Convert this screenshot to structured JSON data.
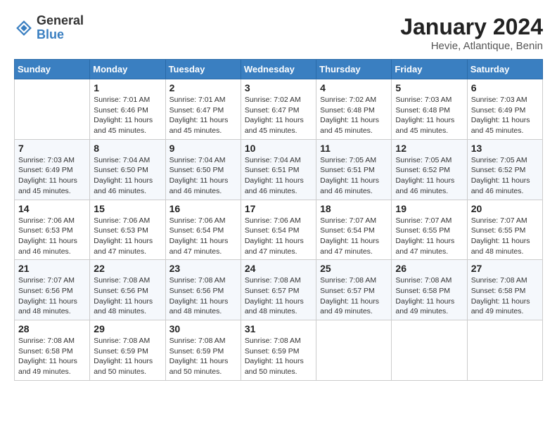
{
  "header": {
    "logo_general": "General",
    "logo_blue": "Blue",
    "month_year": "January 2024",
    "location": "Hevie, Atlantique, Benin"
  },
  "days_of_week": [
    "Sunday",
    "Monday",
    "Tuesday",
    "Wednesday",
    "Thursday",
    "Friday",
    "Saturday"
  ],
  "weeks": [
    [
      {
        "day": "",
        "info": ""
      },
      {
        "day": "1",
        "info": "Sunrise: 7:01 AM\nSunset: 6:46 PM\nDaylight: 11 hours\nand 45 minutes."
      },
      {
        "day": "2",
        "info": "Sunrise: 7:01 AM\nSunset: 6:47 PM\nDaylight: 11 hours\nand 45 minutes."
      },
      {
        "day": "3",
        "info": "Sunrise: 7:02 AM\nSunset: 6:47 PM\nDaylight: 11 hours\nand 45 minutes."
      },
      {
        "day": "4",
        "info": "Sunrise: 7:02 AM\nSunset: 6:48 PM\nDaylight: 11 hours\nand 45 minutes."
      },
      {
        "day": "5",
        "info": "Sunrise: 7:03 AM\nSunset: 6:48 PM\nDaylight: 11 hours\nand 45 minutes."
      },
      {
        "day": "6",
        "info": "Sunrise: 7:03 AM\nSunset: 6:49 PM\nDaylight: 11 hours\nand 45 minutes."
      }
    ],
    [
      {
        "day": "7",
        "info": "Sunrise: 7:03 AM\nSunset: 6:49 PM\nDaylight: 11 hours\nand 45 minutes."
      },
      {
        "day": "8",
        "info": "Sunrise: 7:04 AM\nSunset: 6:50 PM\nDaylight: 11 hours\nand 46 minutes."
      },
      {
        "day": "9",
        "info": "Sunrise: 7:04 AM\nSunset: 6:50 PM\nDaylight: 11 hours\nand 46 minutes."
      },
      {
        "day": "10",
        "info": "Sunrise: 7:04 AM\nSunset: 6:51 PM\nDaylight: 11 hours\nand 46 minutes."
      },
      {
        "day": "11",
        "info": "Sunrise: 7:05 AM\nSunset: 6:51 PM\nDaylight: 11 hours\nand 46 minutes."
      },
      {
        "day": "12",
        "info": "Sunrise: 7:05 AM\nSunset: 6:52 PM\nDaylight: 11 hours\nand 46 minutes."
      },
      {
        "day": "13",
        "info": "Sunrise: 7:05 AM\nSunset: 6:52 PM\nDaylight: 11 hours\nand 46 minutes."
      }
    ],
    [
      {
        "day": "14",
        "info": "Sunrise: 7:06 AM\nSunset: 6:53 PM\nDaylight: 11 hours\nand 46 minutes."
      },
      {
        "day": "15",
        "info": "Sunrise: 7:06 AM\nSunset: 6:53 PM\nDaylight: 11 hours\nand 47 minutes."
      },
      {
        "day": "16",
        "info": "Sunrise: 7:06 AM\nSunset: 6:54 PM\nDaylight: 11 hours\nand 47 minutes."
      },
      {
        "day": "17",
        "info": "Sunrise: 7:06 AM\nSunset: 6:54 PM\nDaylight: 11 hours\nand 47 minutes."
      },
      {
        "day": "18",
        "info": "Sunrise: 7:07 AM\nSunset: 6:54 PM\nDaylight: 11 hours\nand 47 minutes."
      },
      {
        "day": "19",
        "info": "Sunrise: 7:07 AM\nSunset: 6:55 PM\nDaylight: 11 hours\nand 47 minutes."
      },
      {
        "day": "20",
        "info": "Sunrise: 7:07 AM\nSunset: 6:55 PM\nDaylight: 11 hours\nand 48 minutes."
      }
    ],
    [
      {
        "day": "21",
        "info": "Sunrise: 7:07 AM\nSunset: 6:56 PM\nDaylight: 11 hours\nand 48 minutes."
      },
      {
        "day": "22",
        "info": "Sunrise: 7:08 AM\nSunset: 6:56 PM\nDaylight: 11 hours\nand 48 minutes."
      },
      {
        "day": "23",
        "info": "Sunrise: 7:08 AM\nSunset: 6:56 PM\nDaylight: 11 hours\nand 48 minutes."
      },
      {
        "day": "24",
        "info": "Sunrise: 7:08 AM\nSunset: 6:57 PM\nDaylight: 11 hours\nand 48 minutes."
      },
      {
        "day": "25",
        "info": "Sunrise: 7:08 AM\nSunset: 6:57 PM\nDaylight: 11 hours\nand 49 minutes."
      },
      {
        "day": "26",
        "info": "Sunrise: 7:08 AM\nSunset: 6:58 PM\nDaylight: 11 hours\nand 49 minutes."
      },
      {
        "day": "27",
        "info": "Sunrise: 7:08 AM\nSunset: 6:58 PM\nDaylight: 11 hours\nand 49 minutes."
      }
    ],
    [
      {
        "day": "28",
        "info": "Sunrise: 7:08 AM\nSunset: 6:58 PM\nDaylight: 11 hours\nand 49 minutes."
      },
      {
        "day": "29",
        "info": "Sunrise: 7:08 AM\nSunset: 6:59 PM\nDaylight: 11 hours\nand 50 minutes."
      },
      {
        "day": "30",
        "info": "Sunrise: 7:08 AM\nSunset: 6:59 PM\nDaylight: 11 hours\nand 50 minutes."
      },
      {
        "day": "31",
        "info": "Sunrise: 7:08 AM\nSunset: 6:59 PM\nDaylight: 11 hours\nand 50 minutes."
      },
      {
        "day": "",
        "info": ""
      },
      {
        "day": "",
        "info": ""
      },
      {
        "day": "",
        "info": ""
      }
    ]
  ]
}
